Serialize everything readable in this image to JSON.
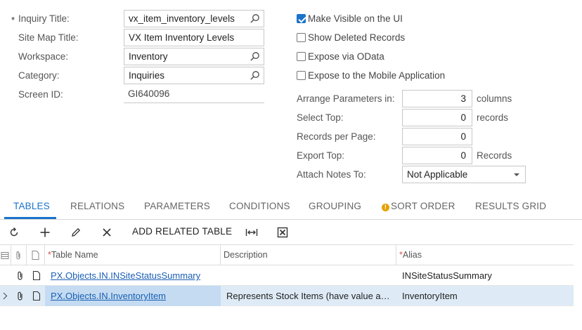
{
  "form": {
    "required_marker": "*",
    "inquiry_title": {
      "label": "Inquiry Title:",
      "value": "vx_item_inventory_levels"
    },
    "site_map_title": {
      "label": "Site Map Title:",
      "value": "VX Item Inventory Levels"
    },
    "workspace": {
      "label": "Workspace:",
      "value": "Inventory"
    },
    "category": {
      "label": "Category:",
      "value": "Inquiries"
    },
    "screen_id": {
      "label": "Screen ID:",
      "value": "GI640096"
    }
  },
  "options": {
    "make_visible": {
      "label": "Make Visible on the UI",
      "checked": true
    },
    "show_deleted": {
      "label": "Show Deleted Records",
      "checked": false
    },
    "expose_odata": {
      "label": "Expose via OData",
      "checked": false
    },
    "expose_mobile": {
      "label": "Expose to the Mobile Application",
      "checked": false
    }
  },
  "params": {
    "arrange": {
      "label": "Arrange Parameters in:",
      "value": "3",
      "unit": "columns"
    },
    "select_top": {
      "label": "Select Top:",
      "value": "0",
      "unit": "records"
    },
    "records_per_page": {
      "label": "Records per Page:",
      "value": "0"
    },
    "export_top": {
      "label": "Export Top:",
      "value": "0",
      "unit": "Records"
    },
    "attach_notes": {
      "label": "Attach Notes To:",
      "value": "Not Applicable"
    }
  },
  "tabs": [
    {
      "label": "TABLES",
      "active": true
    },
    {
      "label": "RELATIONS"
    },
    {
      "label": "PARAMETERS"
    },
    {
      "label": "CONDITIONS"
    },
    {
      "label": "GROUPING"
    },
    {
      "label": "SORT ORDER",
      "warning": true
    },
    {
      "label": "RESULTS GRID"
    }
  ],
  "toolbar": {
    "refresh_icon": "refresh-icon",
    "add_icon": "plus-icon",
    "edit_icon": "pencil-icon",
    "delete_icon": "x-icon",
    "add_related_label": "ADD RELATED TABLE",
    "fit_icon": "fit-width-icon",
    "export_icon": "excel-export-icon"
  },
  "grid": {
    "columns": {
      "table_name": "Table Name",
      "description": "Description",
      "alias": "Alias"
    },
    "rows": [
      {
        "table_name": "PX.Objects.IN.INSiteStatusSummary",
        "description": "",
        "alias": "INSiteStatusSummary",
        "selected": false
      },
      {
        "table_name": "PX.Objects.IN.InventoryItem",
        "description": "Represents Stock Items (have value a…",
        "alias": "InventoryItem",
        "selected": true
      }
    ]
  },
  "colors": {
    "accent": "#1a73c9",
    "selected_row": "#deebf7",
    "link": "#1a5fb4",
    "warning": "#e6a100"
  }
}
